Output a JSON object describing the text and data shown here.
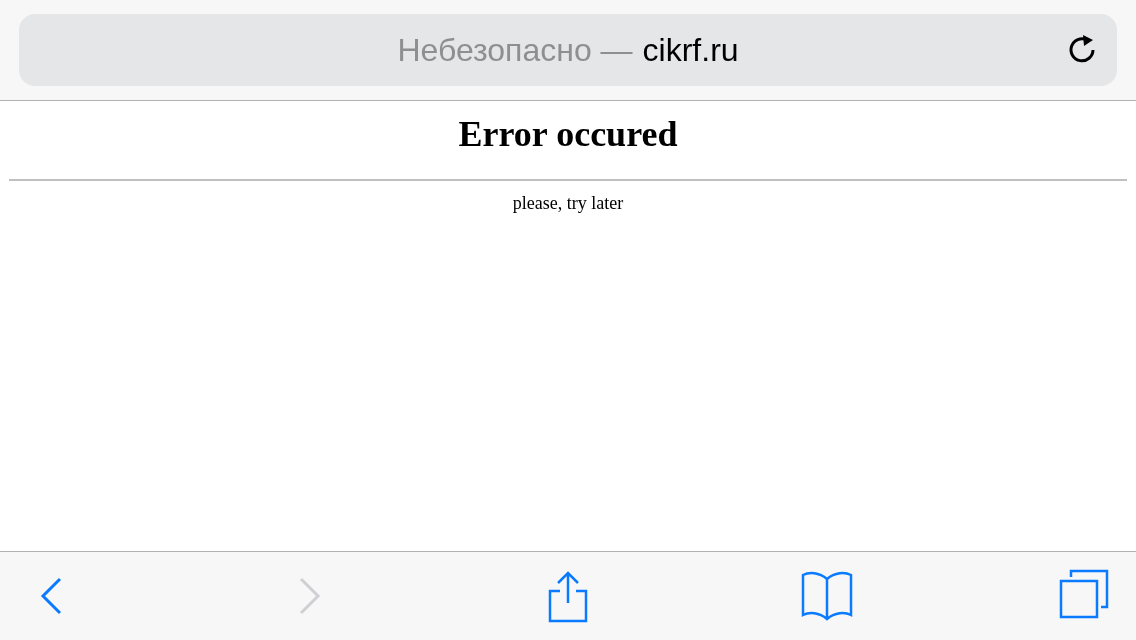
{
  "address_bar": {
    "security_label": "Небезопасно —",
    "domain": "cikrf.ru"
  },
  "page": {
    "heading": "Error occured",
    "message": "please, try later"
  },
  "toolbar": [
    {
      "kind": "back",
      "disabled": false
    },
    {
      "kind": "forward",
      "disabled": true
    },
    {
      "kind": "share",
      "disabled": false
    },
    {
      "kind": "bookmarks",
      "disabled": false
    },
    {
      "kind": "tabs",
      "disabled": false
    }
  ]
}
